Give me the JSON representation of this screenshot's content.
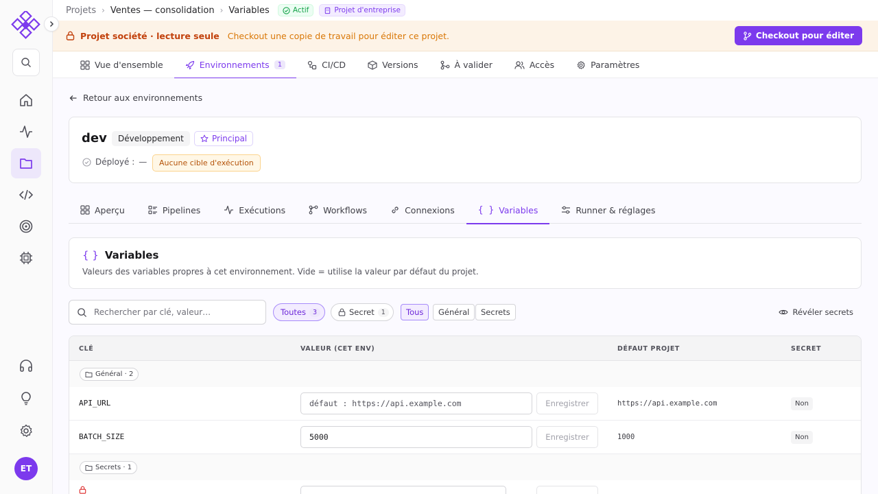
{
  "breadcrumb": [
    "Projets",
    "Ventes — consolidation",
    "Variables"
  ],
  "badges": {
    "status": "Actif",
    "type": "Projet d'entreprise"
  },
  "banner": {
    "title": "Projet société · lecture seule",
    "message": "Checkout une copie de travail pour éditer ce projet.",
    "button": "Checkout pour éditer"
  },
  "nav_tabs": [
    {
      "label": "Vue d'ensemble",
      "icon": "grid-icon"
    },
    {
      "label": "Environnements",
      "icon": "rocket-icon",
      "count": "1",
      "active": true
    },
    {
      "label": "CI/CD",
      "icon": "cicd-icon"
    },
    {
      "label": "Versions",
      "icon": "package-icon"
    },
    {
      "label": "À valider",
      "icon": "git-merge-icon"
    },
    {
      "label": "Accès",
      "icon": "users-icon"
    },
    {
      "label": "Paramètres",
      "icon": "gear-icon"
    }
  ],
  "back_link": "Retour aux environnements",
  "environment": {
    "name": "dev",
    "kind": "Développement",
    "principal": "Principal",
    "deployed_label": "Déployé :",
    "deployed_value": "—",
    "warning": "Aucune cible d'exécution"
  },
  "sub_tabs": [
    {
      "label": "Aperçu",
      "icon": "grid-icon"
    },
    {
      "label": "Pipelines",
      "icon": "list-icon"
    },
    {
      "label": "Exécutions",
      "icon": "activity-icon"
    },
    {
      "label": "Workflows",
      "icon": "workflow-icon"
    },
    {
      "label": "Connexions",
      "icon": "link-icon"
    },
    {
      "label": "Variables",
      "icon": "braces-icon",
      "active": true
    },
    {
      "label": "Runner & réglages",
      "icon": "sliders-icon"
    }
  ],
  "variables_card": {
    "title": "Variables",
    "icon_text": "{ }",
    "description": "Valeurs des variables propres à cet environnement. Vide = utilise la valeur par défaut du projet."
  },
  "toolbar": {
    "search_placeholder": "Rechercher par clé, valeur…",
    "chip_all": "Toutes",
    "chip_all_count": "3",
    "chip_secret": "Secret",
    "chip_secret_count": "1",
    "seg_all": "Tous",
    "seg_general": "Général",
    "seg_secrets": "Secrets",
    "reveal": "Révéler secrets"
  },
  "table": {
    "headers": {
      "key": "CLÉ",
      "value": "VALEUR (CET ENV)",
      "default": "DÉFAUT PROJET",
      "secret": "SECRET"
    },
    "group_general": "Général · 2",
    "group_secrets": "Secrets · 1",
    "rows": [
      {
        "key": "API_URL",
        "value": "défaut : https://api.example.com",
        "default": "https://api.example.com",
        "secret": "Non",
        "save": "Enregistrer"
      },
      {
        "key": "BATCH_SIZE",
        "value": "5000",
        "default": "1000",
        "secret": "Non",
        "save": "Enregistrer"
      }
    ]
  },
  "avatar": "ET",
  "colors": {
    "accent": "#7c3aed",
    "warning_bg": "#fdf3e7",
    "success": "#16a34a"
  }
}
